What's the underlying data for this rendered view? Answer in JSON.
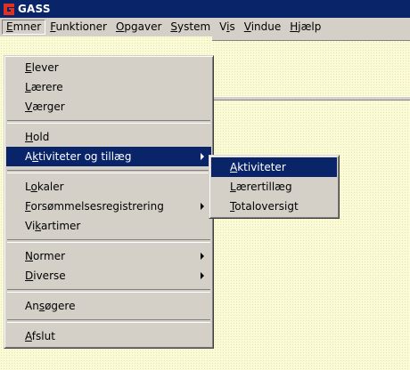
{
  "window": {
    "title": "GASS"
  },
  "menubar": [
    {
      "pre": "",
      "acc": "E",
      "post": "mner",
      "active": true
    },
    {
      "pre": "",
      "acc": "F",
      "post": "unktioner"
    },
    {
      "pre": "",
      "acc": "O",
      "post": "pgaver"
    },
    {
      "pre": "",
      "acc": "S",
      "post": "ystem"
    },
    {
      "pre": "V",
      "acc": "i",
      "post": "s"
    },
    {
      "pre": "",
      "acc": "V",
      "post": "indue"
    },
    {
      "pre": "",
      "acc": "H",
      "post": "jælp"
    }
  ],
  "emner_menu": [
    {
      "pre": "",
      "acc": "E",
      "post": "lever"
    },
    {
      "pre": "",
      "acc": "L",
      "post": "ærere"
    },
    {
      "pre": "",
      "acc": "V",
      "post": "ærger"
    },
    {
      "sep": true
    },
    {
      "pre": "",
      "acc": "H",
      "post": "old"
    },
    {
      "pre": "A",
      "acc": "k",
      "post": "tiviteter og tillæg",
      "submenu": true,
      "highlighted": true
    },
    {
      "sep": true
    },
    {
      "pre": "L",
      "acc": "o",
      "post": "kaler"
    },
    {
      "pre": "",
      "acc": "F",
      "post": "orsømmelsesregistrering",
      "submenu": true
    },
    {
      "pre": "Vi",
      "acc": "k",
      "post": "artimer"
    },
    {
      "sep": true
    },
    {
      "pre": "",
      "acc": "N",
      "post": "ormer",
      "submenu": true
    },
    {
      "pre": "",
      "acc": "D",
      "post": "iverse",
      "submenu": true
    },
    {
      "sep": true
    },
    {
      "pre": "An",
      "acc": "s",
      "post": "øgere"
    },
    {
      "sep": true
    },
    {
      "pre": "",
      "acc": "A",
      "post": "fslut"
    }
  ],
  "aktiviteter_submenu": [
    {
      "pre": "",
      "acc": "A",
      "post": "ktiviteter",
      "highlighted": true
    },
    {
      "pre": "",
      "acc": "L",
      "post": "ærertillæg"
    },
    {
      "pre": "",
      "acc": "T",
      "post": "otaloversigt"
    }
  ],
  "colors": {
    "titlebar": "#0a246a",
    "highlight": "#0a246a",
    "face": "#d4d0c8",
    "client": "#fbfbd6",
    "icon": "#e03020"
  }
}
